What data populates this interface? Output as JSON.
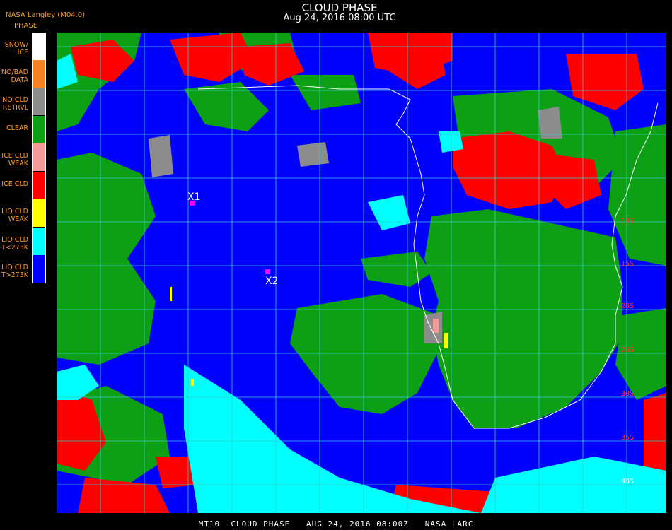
{
  "header": {
    "title": "CLOUD PHASE",
    "datetime": "Aug 24, 2016 08:00 UTC",
    "organization": "NASA Langley (M04.0)"
  },
  "legend": {
    "title": "PHASE",
    "items": [
      {
        "label": "SNOW/\nICE",
        "color": "#ffffff"
      },
      {
        "label": "NO/BAD\nDATA",
        "color": "#f58220"
      },
      {
        "label": "NO CLD\nRETRVL",
        "color": "#8c8c8c"
      },
      {
        "label": "CLEAR",
        "color": "#0ea014"
      },
      {
        "label": "ICE CLD\nWEAK",
        "color": "#f49a9a"
      },
      {
        "label": "ICE CLD",
        "color": "#ff0000"
      },
      {
        "label": "LIQ CLD\nWEAK",
        "color": "#ffff00"
      },
      {
        "label": "LIQ CLD\nT<273K",
        "color": "#00ffff"
      },
      {
        "label": "LIQ CLD\nT>273K",
        "color": "#0000ff"
      }
    ]
  },
  "map": {
    "colors": {
      "ocean_liquid": "#0000ff",
      "clear": "#0ea014",
      "ice": "#ff0000",
      "liquid_cold": "#00ffff",
      "no_retrieval": "#8c8c8c",
      "weak_liquid": "#ffff00",
      "weak_ice": "#f49a9a",
      "grid": "#33cccc",
      "coast": "#ffffff"
    },
    "markers": [
      {
        "label": "X1",
        "color": "#ff00ff"
      },
      {
        "label": "X2",
        "color": "#ff00ff"
      }
    ],
    "lat_labels": [
      "10S",
      "15S",
      "20S",
      "25S",
      "30S",
      "35S",
      "40S"
    ]
  },
  "footer": {
    "text": "MT10  CLOUD PHASE   AUG 24, 2016 08:00Z   NASA LARC"
  }
}
